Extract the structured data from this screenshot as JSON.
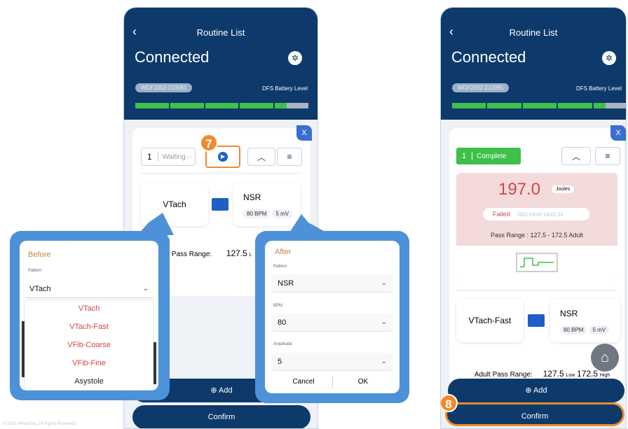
{
  "left_phone": {
    "title": "Routine List",
    "status": "Connected",
    "serial": "WDF2002-210081",
    "battery_label": "DFS Battery Level",
    "step_number": "1",
    "step_status": "Waiting···",
    "close_label": "X",
    "callout_number": "7",
    "rhythm_from": "VTach",
    "rhythm_to": "NSR",
    "bpm": "80 BPM",
    "amplitude": "5 mV",
    "pass_range_label": "lt Pass Range:",
    "pass_range_value": "127.5",
    "pass_range_unit": "L",
    "add_label": "Add",
    "confirm_label": "Confirm"
  },
  "before_popout": {
    "title": "Before",
    "field_label": "Pattern",
    "selected": "VTach",
    "options": [
      "VTach",
      "VTach-Fast",
      "VFib-Coarse",
      "VFib-Fine",
      "Asystole"
    ]
  },
  "after_popout": {
    "title": "After",
    "pattern_label": "Pattern",
    "pattern_value": "NSR",
    "bpm_label": "BPM",
    "bpm_value": "80",
    "amplitude_label": "Amplitude",
    "amplitude_value": "5",
    "cancel_label": "Cancel",
    "ok_label": "OK"
  },
  "right_phone": {
    "title": "Routine List",
    "status": "Connected",
    "serial": "WDF2002-210081",
    "battery_label": "DFS Battery Level",
    "close_label": "X",
    "step_number": "1",
    "step_status": "Complete",
    "energy": "197.0",
    "energy_unit": "Joules",
    "result": "Failed",
    "timestamp": "2021-03-07 14:01:23",
    "pass_range": "Pass Range : 127.5 - 172.5   Adult",
    "rhythm_from": "VTach-Fast",
    "rhythm_to": "NSR",
    "bpm": "80 BPM",
    "amplitude": "5 mV",
    "adult_pass_label": "Adult Pass Range:",
    "low_value": "127.5",
    "low_label": "Low",
    "high_value": "172.5",
    "high_label": "High",
    "add_label": "Add",
    "confirm_label": "Confirm",
    "callout_number": "8"
  },
  "footer_text": "© 2021 WhaleTeq. All Rights Reserved.",
  "colors": {
    "navy": "#0d3a6b",
    "green": "#3ec04a",
    "orange": "#f08a2c",
    "blue": "#4d91d8",
    "red": "#d64545"
  }
}
